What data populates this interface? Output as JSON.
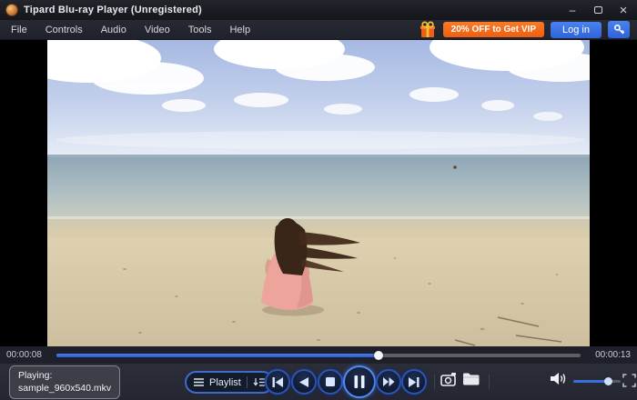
{
  "window": {
    "title": "Tipard Blu-ray Player (Unregistered)",
    "controls": {
      "minimize": "–",
      "close": "×"
    }
  },
  "menu": {
    "items": [
      {
        "label": "File"
      },
      {
        "label": "Controls"
      },
      {
        "label": "Audio"
      },
      {
        "label": "Video"
      },
      {
        "label": "Tools"
      },
      {
        "label": "Help"
      }
    ]
  },
  "promo": {
    "gift_icon": "gift-box",
    "offer_label": "20% OFF to Get VIP",
    "login_label": "Log in",
    "register_icon": "key"
  },
  "player": {
    "current_time": "00:00:08",
    "total_time": "00:00:13",
    "progress_pct": 61.5,
    "volume_pct": 74,
    "now_playing": {
      "line1": "Playing:",
      "line2": "sample_960x540.mkv"
    },
    "playlist_label": "Playlist",
    "transport": [
      "previous",
      "rewind",
      "stop",
      "pause",
      "forward",
      "next"
    ],
    "extra_buttons": [
      "snapshot",
      "open-file"
    ],
    "right_buttons": [
      "volume",
      "fullscreen"
    ]
  },
  "colors": {
    "accent_blue": "#3471e8",
    "seek_blue": "#2f6ae0",
    "promo_orange": "#f2671f",
    "bar_background": "#272934",
    "ring_blue": "#2a55b6",
    "pause_ring": "#4f8cf5"
  },
  "scene": {
    "description": "woman in pink top sitting on sandy beach facing the ocean under blue cloudy sky"
  }
}
